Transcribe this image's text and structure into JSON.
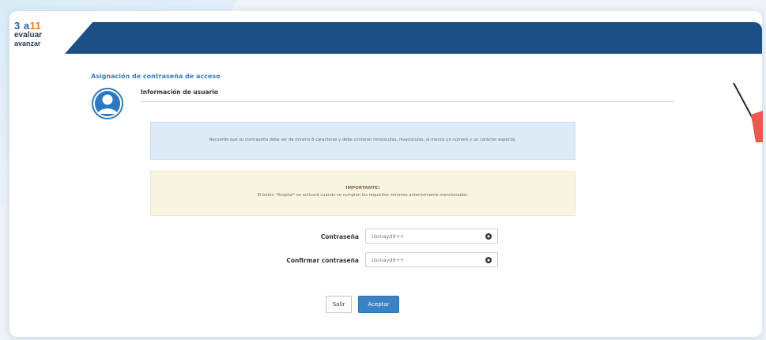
{
  "logo": {
    "line1_prefix": "3 a",
    "line1_num": "11",
    "line2": "evaluar",
    "line3": "avanzar"
  },
  "section_title": "Asignación de contraseña de acceso",
  "user_info": {
    "heading": "Información de usuario"
  },
  "alerts": {
    "info_text": "Recuerde que su contraseña debe ser de mínimo 8 caracteres y debe contener minúsculas, mayúsculas, al menos un número y un carácter especial.",
    "warning_title": "IMPORTANTE!",
    "warning_text": "El botón \"Aceptar\" se activará cuando se cumplan los requisitos mínimos anteriormente mencionados."
  },
  "form": {
    "password_label": "Contraseña",
    "password_value": "Usmayd9++",
    "confirm_label": "Confirmar contraseña",
    "confirm_value": "Usmayd9++"
  },
  "buttons": {
    "exit": "Salir",
    "accept": "Aceptar"
  },
  "colors": {
    "header": "#1d4f86",
    "accent": "#3a83c4",
    "info_bg": "#dcebf6",
    "warn_bg": "#f8f4e2"
  },
  "icons": [
    "user-avatar-icon",
    "eye-icon"
  ]
}
